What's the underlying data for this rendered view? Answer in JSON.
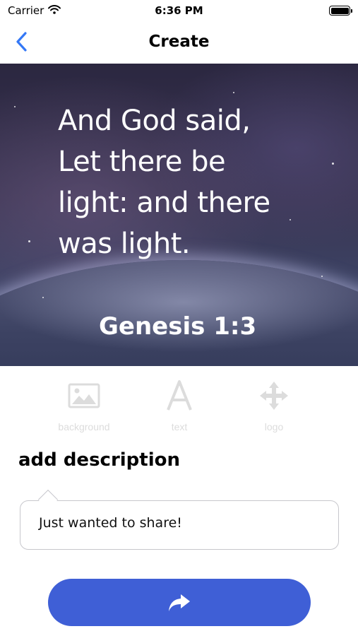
{
  "status_bar": {
    "carrier": "Carrier",
    "time": "6:36 PM"
  },
  "nav": {
    "title": "Create",
    "back_icon": "chevron-left-icon",
    "accent_color": "#3478f6"
  },
  "preview": {
    "verse": "And God said, Let there be light: and there was light.",
    "reference": "Genesis 1:3"
  },
  "tools": [
    {
      "label": "background",
      "icon": "image-icon"
    },
    {
      "label": "text",
      "icon": "text-icon"
    },
    {
      "label": "logo",
      "icon": "move-arrows-icon"
    }
  ],
  "description": {
    "title": "add description",
    "value": "Just wanted to share!"
  },
  "share_button": {
    "icon": "share-arrow-icon",
    "color": "#3f5fd6"
  }
}
